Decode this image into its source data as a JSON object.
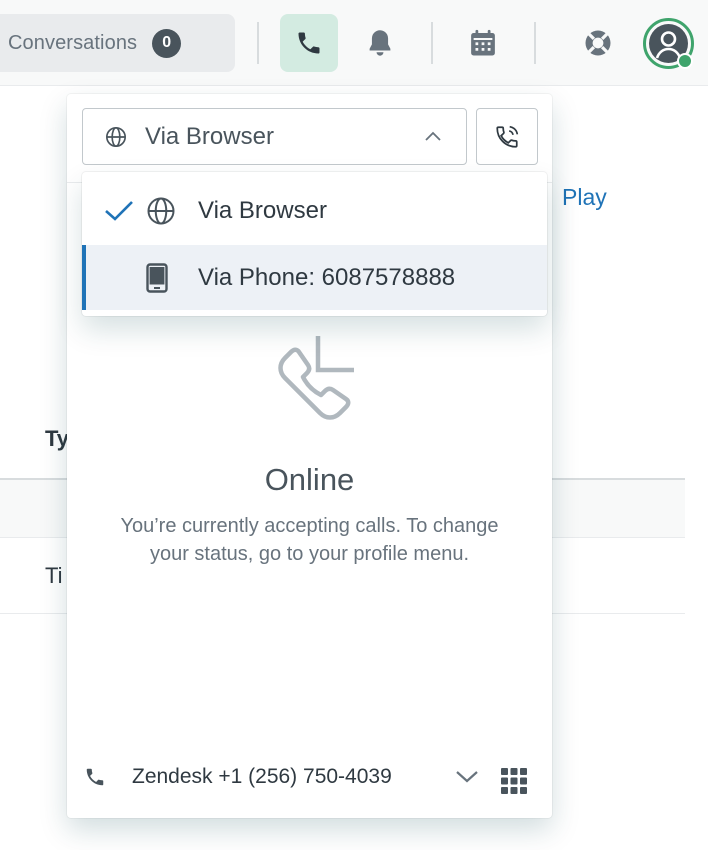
{
  "topbar": {
    "conversations_label": "Conversations",
    "conversations_count": "0"
  },
  "background": {
    "play_link": "Play",
    "column_header_fragment": "Ty",
    "row_fragment": "Ti"
  },
  "call_panel": {
    "mode_select_value": "Via Browser",
    "menu": {
      "items": [
        {
          "label": "Via Browser",
          "selected": true,
          "icon": "globe-icon"
        },
        {
          "label": "Via Phone: 6087578888",
          "selected": false,
          "highlighted": true,
          "icon": "mobile-phone-icon"
        }
      ]
    },
    "status_title": "Online",
    "status_description": "You’re currently accepting calls. To change your status, go to your profile menu.",
    "footer": {
      "line_label": "Zendesk +1 (256) 750-4039"
    }
  },
  "colors": {
    "accent": "#1f73b7",
    "presence_online": "#3fa46c",
    "active_tab_bg": "#d3ebe1"
  }
}
